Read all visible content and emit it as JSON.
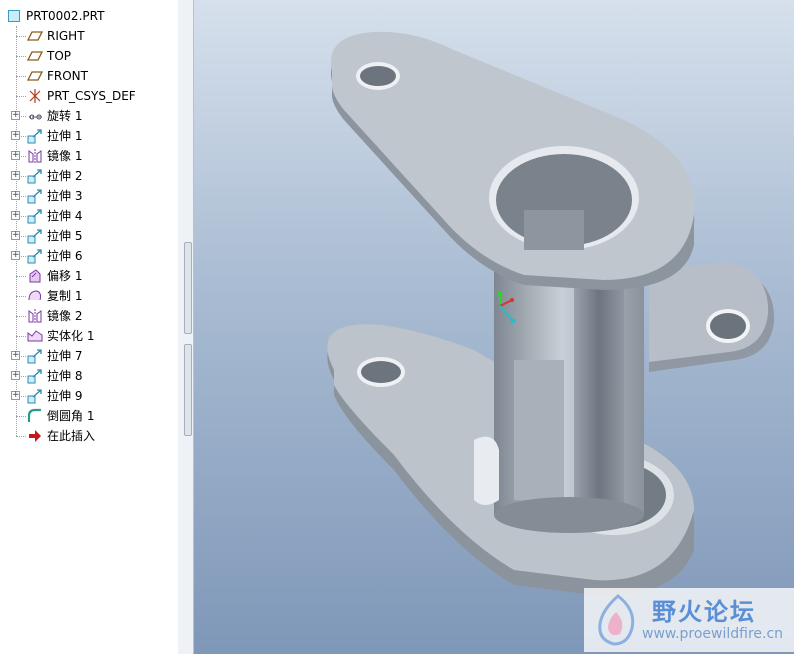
{
  "model_tree": {
    "root": {
      "label": "PRT0002.PRT",
      "icon": "part-icon"
    },
    "items": [
      {
        "label": "RIGHT",
        "icon": "datum-plane-icon",
        "expandable": false
      },
      {
        "label": "TOP",
        "icon": "datum-plane-icon",
        "expandable": false
      },
      {
        "label": "FRONT",
        "icon": "datum-plane-icon",
        "expandable": false
      },
      {
        "label": "PRT_CSYS_DEF",
        "icon": "coordinate-system-icon",
        "expandable": false
      },
      {
        "label": "旋转 1",
        "icon": "revolve-icon",
        "expandable": true
      },
      {
        "label": "拉伸 1",
        "icon": "extrude-icon",
        "expandable": true
      },
      {
        "label": "镜像 1",
        "icon": "mirror-icon",
        "expandable": true
      },
      {
        "label": "拉伸 2",
        "icon": "extrude-icon",
        "expandable": true
      },
      {
        "label": "拉伸 3",
        "icon": "extrude-icon",
        "expandable": true
      },
      {
        "label": "拉伸 4",
        "icon": "extrude-icon",
        "expandable": true
      },
      {
        "label": "拉伸 5",
        "icon": "extrude-icon",
        "expandable": true
      },
      {
        "label": "拉伸 6",
        "icon": "extrude-icon",
        "expandable": true
      },
      {
        "label": "偏移 1",
        "icon": "offset-icon",
        "expandable": false
      },
      {
        "label": "复制 1",
        "icon": "copy-icon",
        "expandable": false
      },
      {
        "label": "镜像 2",
        "icon": "mirror-icon",
        "expandable": false
      },
      {
        "label": "实体化 1",
        "icon": "solidify-icon",
        "expandable": false
      },
      {
        "label": "拉伸 7",
        "icon": "extrude-icon",
        "expandable": true
      },
      {
        "label": "拉伸 8",
        "icon": "extrude-icon",
        "expandable": true
      },
      {
        "label": "拉伸 9",
        "icon": "extrude-icon",
        "expandable": true
      },
      {
        "label": "倒圆角 1",
        "icon": "round-icon",
        "expandable": false
      },
      {
        "label": "在此插入",
        "icon": "insert-here-arrow-icon",
        "expandable": false
      }
    ]
  },
  "watermark": {
    "title": "野火论坛",
    "url": "www.proewildfire.cn"
  },
  "colors": {
    "viewport_top": "#d6e0ec",
    "viewport_bottom": "#7f97b8",
    "part_fill": "#b9c0c9",
    "accent": "#3a9cc6"
  }
}
